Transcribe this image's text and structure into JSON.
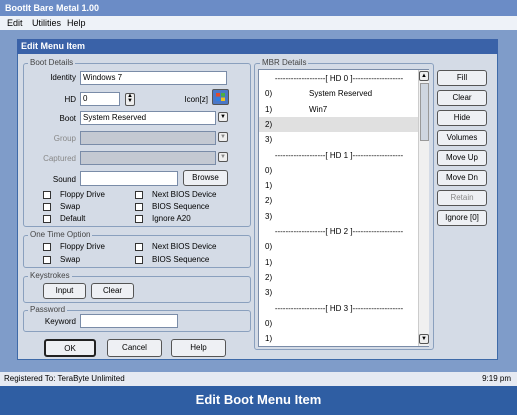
{
  "app": {
    "title": "BootIt Bare Metal 1.00"
  },
  "menubar": {
    "items": [
      "Edit",
      "Utilities",
      "Help"
    ]
  },
  "dialog": {
    "title": "Edit Menu Item",
    "boot_details": {
      "legend": "Boot Details",
      "identity_label": "Identity",
      "identity_value": "Windows 7",
      "hd_label": "HD",
      "hd_value": "0",
      "icon_label": "Icon[z]",
      "boot_label": "Boot",
      "boot_value": "System Reserved",
      "group_label": "Group",
      "captured_label": "Captured",
      "sound_label": "Sound",
      "browse_button": "Browse",
      "checkboxes": [
        "Floppy Drive",
        "Swap",
        "Default",
        "Next BIOS Device",
        "BIOS Sequence",
        "Ignore A20"
      ]
    },
    "one_time": {
      "legend": "One Time Option",
      "checkboxes": [
        "Floppy Drive",
        "Swap",
        "Next BIOS Device",
        "BIOS Sequence"
      ]
    },
    "keystrokes": {
      "legend": "Keystrokes",
      "input_button": "Input",
      "clear_button": "Clear"
    },
    "password": {
      "legend": "Password",
      "keyword_label": "Keyword"
    },
    "buttons": {
      "ok": "OK",
      "cancel": "Cancel",
      "help": "Help"
    },
    "mbr": {
      "legend": "MBR Details",
      "lines": [
        {
          "kind": "hdr",
          "text": "-------------------[ HD 0 ]-------------------"
        },
        {
          "kind": "row",
          "n": "0)",
          "t": "System Reserved"
        },
        {
          "kind": "row",
          "n": "1)",
          "t": "Win7"
        },
        {
          "kind": "row",
          "n": "2)",
          "t": "",
          "selected": true
        },
        {
          "kind": "row",
          "n": "3)",
          "t": ""
        },
        {
          "kind": "hdr",
          "text": "-------------------[ HD 1 ]-------------------"
        },
        {
          "kind": "row",
          "n": "0)",
          "t": ""
        },
        {
          "kind": "row",
          "n": "1)",
          "t": ""
        },
        {
          "kind": "row",
          "n": "2)",
          "t": ""
        },
        {
          "kind": "row",
          "n": "3)",
          "t": ""
        },
        {
          "kind": "hdr",
          "text": "-------------------[ HD 2 ]-------------------"
        },
        {
          "kind": "row",
          "n": "0)",
          "t": ""
        },
        {
          "kind": "row",
          "n": "1)",
          "t": ""
        },
        {
          "kind": "row",
          "n": "2)",
          "t": ""
        },
        {
          "kind": "row",
          "n": "3)",
          "t": ""
        },
        {
          "kind": "hdr",
          "text": "-------------------[ HD 3 ]-------------------"
        },
        {
          "kind": "row",
          "n": "0)",
          "t": ""
        },
        {
          "kind": "row",
          "n": "1)",
          "t": ""
        }
      ]
    },
    "side_buttons": [
      "Fill",
      "Clear",
      "Hide",
      "Volumes",
      "Move Up",
      "Move Dn",
      "Retain",
      "Ignore [0]"
    ]
  },
  "status": {
    "left": "Registered To: TeraByte Unlimited",
    "time": "9:19 pm"
  },
  "banner": "Edit Boot Menu Item"
}
